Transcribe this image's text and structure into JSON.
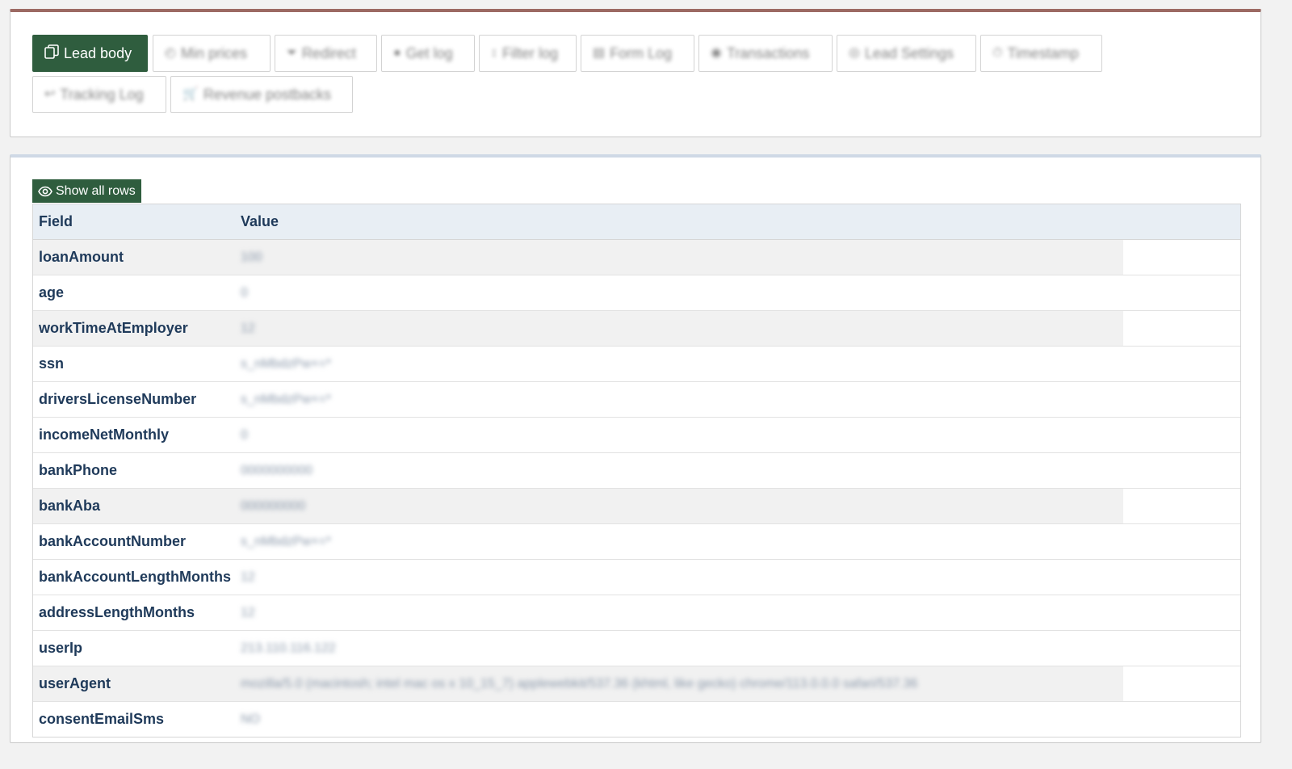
{
  "tabs": [
    {
      "label": "Lead body",
      "icon": "copy-icon",
      "active": true
    },
    {
      "label": "Min prices",
      "icon": "clock-icon"
    },
    {
      "label": "Redirect",
      "icon": "filter-icon"
    },
    {
      "label": "Get log",
      "icon": "drop-icon"
    },
    {
      "label": "Filter log",
      "icon": "arrows-vertical-icon"
    },
    {
      "label": "Form Log",
      "icon": "form-icon"
    },
    {
      "label": "Transactions",
      "icon": "coin-icon"
    },
    {
      "label": "Lead Settings",
      "icon": "settings-icon"
    },
    {
      "label": "Timestamp",
      "icon": "timer-icon"
    },
    {
      "label": "Tracking Log",
      "icon": "reply-icon"
    },
    {
      "label": "Revenue postbacks",
      "icon": "cart-icon"
    }
  ],
  "show_all_rows_label": "Show all rows",
  "table": {
    "headers": {
      "field": "Field",
      "value": "Value"
    },
    "rows": [
      {
        "field": "loanAmount",
        "value": "100"
      },
      {
        "field": "age",
        "value": "0"
      },
      {
        "field": "workTimeAtEmployer",
        "value": "12"
      },
      {
        "field": "ssn",
        "value": "s_nMbdzPw+=*"
      },
      {
        "field": "driversLicenseNumber",
        "value": "s_nMbdzPw+=*"
      },
      {
        "field": "incomeNetMonthly",
        "value": "0"
      },
      {
        "field": "bankPhone",
        "value": "0000000000"
      },
      {
        "field": "bankAba",
        "value": "000000000"
      },
      {
        "field": "bankAccountNumber",
        "value": "s_nMbdzPw+=*"
      },
      {
        "field": "bankAccountLengthMonths",
        "value": "12"
      },
      {
        "field": "addressLengthMonths",
        "value": "12"
      },
      {
        "field": "userIp",
        "value": "213.110.116.122"
      },
      {
        "field": "userAgent",
        "value": "mozilla/5.0 (macintosh; intel mac os x 10_15_7) applewebkit/537.36 (khtml, like gecko) chrome/113.0.0.0 safari/537.36"
      },
      {
        "field": "consentEmailSms",
        "value": "NO"
      }
    ]
  },
  "colors": {
    "accent": "#2f5d3e",
    "top_border": "#9c6a63",
    "header_bg": "#e8eef4"
  }
}
